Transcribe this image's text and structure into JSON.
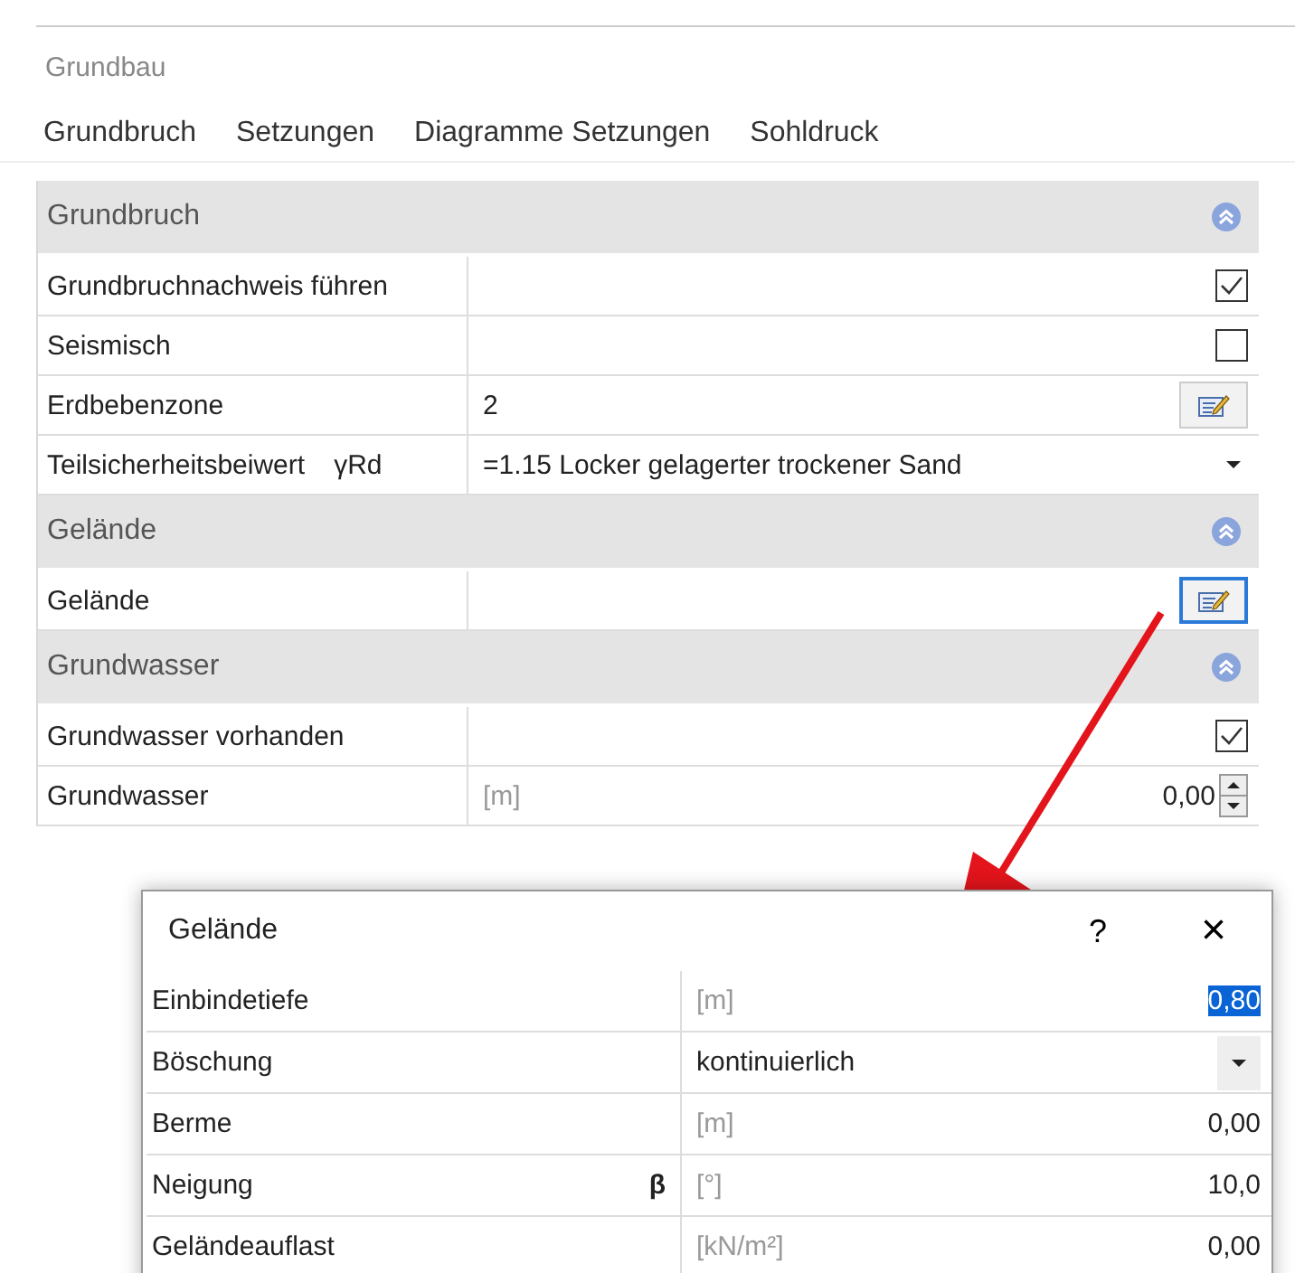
{
  "window": {
    "title": "Grundbau"
  },
  "tabs": [
    {
      "label": "Grundbruch"
    },
    {
      "label": "Setzungen"
    },
    {
      "label": "Diagramme Setzungen"
    },
    {
      "label": "Sohldruck"
    }
  ],
  "sections": [
    {
      "title": "Grundbruch",
      "expanded": true,
      "rows": [
        {
          "kind": "checkbox",
          "label": "Grundbruchnachweis führen",
          "checked": true
        },
        {
          "kind": "checkbox",
          "label": "Seismisch",
          "checked": false
        },
        {
          "kind": "edit",
          "label": "Erdbebenzone",
          "value": "2",
          "focused": false
        },
        {
          "kind": "dropdown",
          "label": "Teilsicherheitsbeiwert",
          "symbol": "γRd",
          "value": "=1.15 Locker gelagerter trockener Sand"
        }
      ]
    },
    {
      "title": "Gelände",
      "expanded": true,
      "rows": [
        {
          "kind": "edit",
          "label": "Gelände",
          "value": "",
          "focused": true
        }
      ]
    },
    {
      "title": "Grundwasser",
      "expanded": true,
      "rows": [
        {
          "kind": "checkbox",
          "label": "Grundwasser vorhanden",
          "checked": true
        },
        {
          "kind": "spin",
          "label": "Grundwasser",
          "unit": "[m]",
          "value": "0,00"
        }
      ]
    }
  ],
  "dialog": {
    "title": "Gelände",
    "help": "?",
    "close": "×",
    "rows": [
      {
        "kind": "number",
        "label": "Einbindetiefe",
        "unit": "[m]",
        "value": "0,80",
        "highlighted": true
      },
      {
        "kind": "dropdown",
        "label": "Böschung",
        "value": "kontinuierlich"
      },
      {
        "kind": "number",
        "label": "Berme",
        "unit": "[m]",
        "value": "0,00",
        "highlighted": false
      },
      {
        "kind": "number",
        "label": "Neigung",
        "symbol": "β",
        "unit": "[°]",
        "value": "10,0",
        "highlighted": false
      },
      {
        "kind": "number",
        "label": "Geländeauflast",
        "unit": "[kN/m²]",
        "value": "0,00",
        "highlighted": false
      }
    ]
  }
}
